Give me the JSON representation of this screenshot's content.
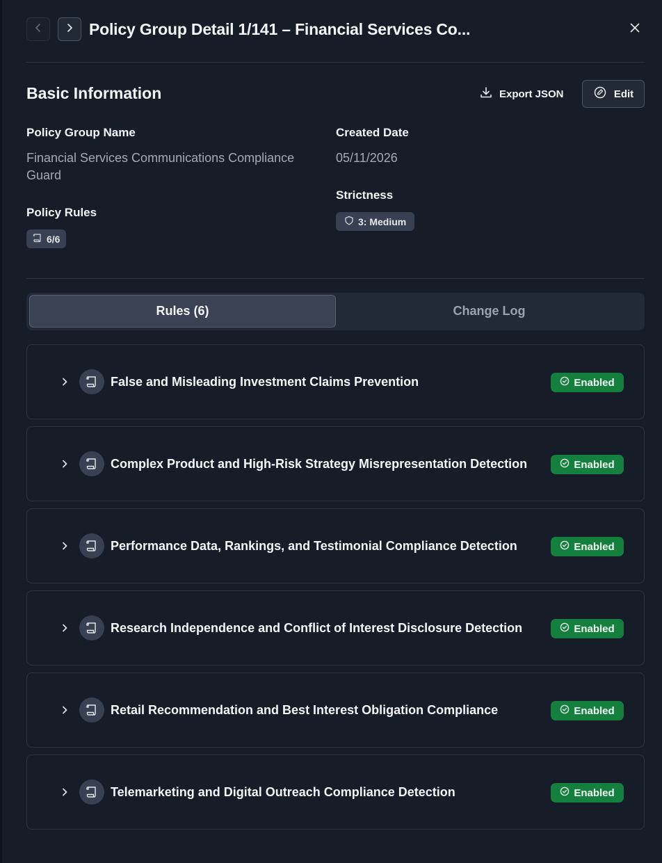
{
  "header": {
    "title": "Policy Group Detail 1/141 – Financial Services Co...",
    "prev_icon": "chevron-left-icon",
    "next_icon": "chevron-right-icon",
    "close_icon": "close-icon"
  },
  "basic_info": {
    "title": "Basic Information",
    "export_label": "Export JSON",
    "edit_label": "Edit",
    "policy_group_name_label": "Policy Group Name",
    "policy_group_name_value": "Financial Services Communications Compliance Guard",
    "created_date_label": "Created Date",
    "created_date_value": "05/11/2026",
    "policy_rules_label": "Policy Rules",
    "policy_rules_value": "6/6",
    "strictness_label": "Strictness",
    "strictness_value": "3: Medium"
  },
  "tabs": [
    {
      "label": "Rules (6)",
      "selected": true
    },
    {
      "label": "Change Log",
      "selected": false
    }
  ],
  "rules": [
    {
      "name": "False and Misleading Investment Claims Prevention",
      "status": "Enabled"
    },
    {
      "name": "Complex Product and High-Risk Strategy Misrepresentation Detection",
      "status": "Enabled"
    },
    {
      "name": "Performance Data, Rankings, and Testimonial Compliance Detection",
      "status": "Enabled"
    },
    {
      "name": "Research Independence and Conflict of Interest Disclosure Detection",
      "status": "Enabled"
    },
    {
      "name": "Retail Recommendation and Best Interest Obligation Compliance",
      "status": "Enabled"
    },
    {
      "name": "Telemarketing and Digital Outreach Compliance Detection",
      "status": "Enabled"
    }
  ],
  "colors": {
    "background": "#161d29",
    "enabled_badge": "#15803d",
    "chip": "#374151"
  }
}
